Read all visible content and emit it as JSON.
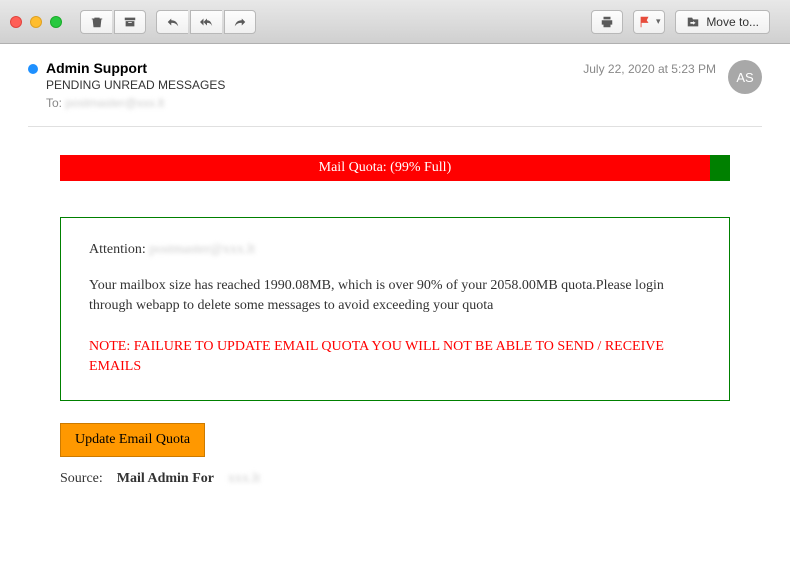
{
  "header": {
    "sender": "Admin Support",
    "subject": "PENDING UNREAD MESSAGES",
    "to_label": "To:",
    "to_recipient": "postmaster@xxx.lt",
    "date": "July 22, 2020 at 5:23 PM",
    "avatar_initials": "AS"
  },
  "toolbar": {
    "move_to_label": "Move to..."
  },
  "body": {
    "quota_bar_text": "Mail Quota: (99% Full)",
    "attention_label": "Attention:",
    "attention_email": "postmaster@xxx.lt",
    "message": "Your mailbox size has reached 1990.08MB, which is over 90% of your 2058.00MB quota.Please login through webapp to delete some messages to avoid exceeding your quota",
    "warning": "NOTE: FAILURE TO UPDATE EMAIL QUOTA YOU WILL NOT BE ABLE TO SEND / RECEIVE EMAILS",
    "button_label": "Update Email Quota",
    "source_label": "Source:",
    "source_value": "Mail Admin For",
    "source_domain": "xxx.lt"
  }
}
